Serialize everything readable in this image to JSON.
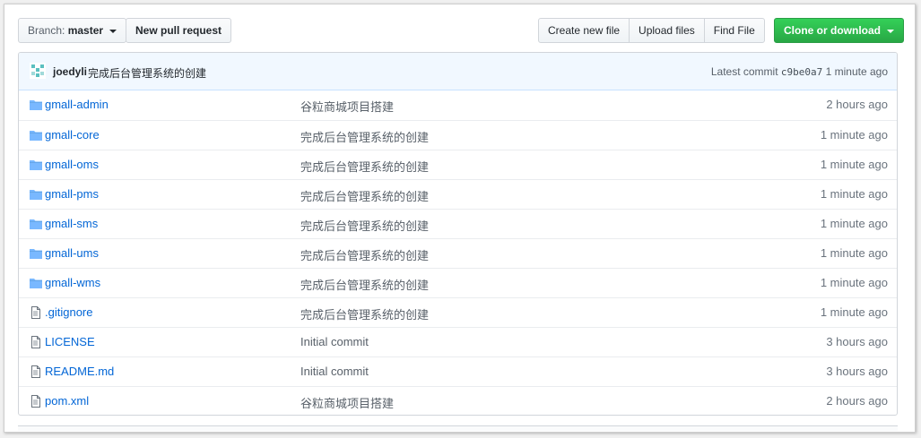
{
  "toolbar": {
    "branch_prefix": "Branch:",
    "branch_name": "master",
    "new_pull_request": "New pull request",
    "create_new_file": "Create new file",
    "upload_files": "Upload files",
    "find_file": "Find File",
    "clone_or_download": "Clone or download"
  },
  "commit": {
    "author": "joedyli",
    "message": "完成后台管理系统的创建",
    "latest_label": "Latest commit",
    "sha": "c9be0a7",
    "age": "1 minute ago"
  },
  "files": [
    {
      "name": "gmall-admin",
      "type": "folder",
      "message": "谷粒商城项目搭建",
      "age": "2 hours ago"
    },
    {
      "name": "gmall-core",
      "type": "folder",
      "message": "完成后台管理系统的创建",
      "age": "1 minute ago"
    },
    {
      "name": "gmall-oms",
      "type": "folder",
      "message": "完成后台管理系统的创建",
      "age": "1 minute ago"
    },
    {
      "name": "gmall-pms",
      "type": "folder",
      "message": "完成后台管理系统的创建",
      "age": "1 minute ago"
    },
    {
      "name": "gmall-sms",
      "type": "folder",
      "message": "完成后台管理系统的创建",
      "age": "1 minute ago"
    },
    {
      "name": "gmall-ums",
      "type": "folder",
      "message": "完成后台管理系统的创建",
      "age": "1 minute ago"
    },
    {
      "name": "gmall-wms",
      "type": "folder",
      "message": "完成后台管理系统的创建",
      "age": "1 minute ago"
    },
    {
      "name": ".gitignore",
      "type": "file",
      "message": "完成后台管理系统的创建",
      "age": "1 minute ago"
    },
    {
      "name": "LICENSE",
      "type": "file",
      "message": "Initial commit",
      "age": "3 hours ago"
    },
    {
      "name": "README.md",
      "type": "file",
      "message": "Initial commit",
      "age": "3 hours ago"
    },
    {
      "name": "pom.xml",
      "type": "file",
      "message": "谷粒商城项目搭建",
      "age": "2 hours ago"
    }
  ],
  "colors": {
    "link": "#0366d6",
    "folder_icon": "#79b8ff",
    "file_icon": "#6a737d",
    "green_button": "#28a745",
    "commit_bar_bg": "#f1f8ff"
  }
}
